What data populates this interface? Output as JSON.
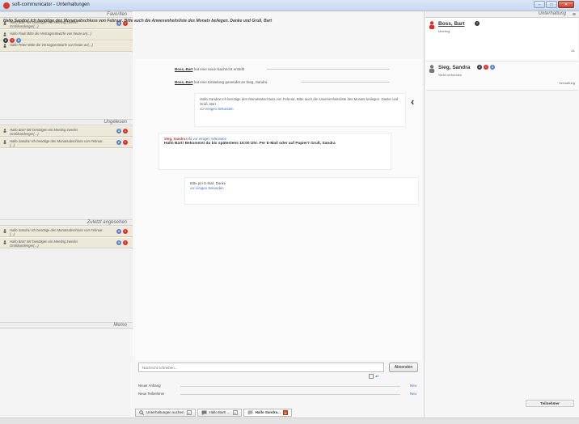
{
  "window": {
    "title": "soft-communicator - Unterhaltungen",
    "minimize": "–",
    "maximize": "□",
    "close": "✕"
  },
  "left": {
    "sections": {
      "favorites": "Favoriten",
      "unread": "Ungelesen",
      "recent": "Zuletzt angesehen",
      "memo": "Memo"
    },
    "favorites": [
      {
        "text": "Hallo Bart! Wir benötigen ein Meeting zwecks Großkundenger(...)",
        "badges": [
          "3",
          "!"
        ]
      },
      {
        "text": "Hallo Paul! Bitte die Vertragsentwürfe von heute an(...)",
        "badges": []
      },
      {
        "text": "Hallo Peter! Bitte die Vertragsentwürfe von heute an(...)",
        "badges": []
      }
    ],
    "unread": [
      {
        "text": "Hallo Bart! Wir benötigen ein Meeting zwecks Großkundenger(...)",
        "badges": [
          "3",
          "!"
        ]
      },
      {
        "text": "Hallo Sandra! Ich benötige den Monatsabschluss von Februar. (...)",
        "badges": [
          "2",
          "!"
        ]
      }
    ],
    "recent": [
      {
        "text": "Hallo Sandra! Ich benötige den Monatsabschluss von Februar. (...)",
        "badges": [
          "2",
          "!"
        ]
      },
      {
        "text": "Hallo Bart! Wir benötigen ein Meeting zwecks Großkundenger(...)",
        "badges": [
          "3",
          "!"
        ]
      }
    ]
  },
  "conversation": {
    "subject": "Hallo Sandra! Ich benötige den Monatsabschluss von Februar. Bitte auch die Anwesenheitsliste des Monats beilegen. Danke und Gruß, Bart",
    "created_prefix": "Erstellt von",
    "created_by": "Boss, Bart",
    "created_time": "vor einigen Sekunden",
    "last_prefix": "Letzte Nachricht von",
    "last_by": "Boss, Bart",
    "last_time": "vor einigen Sekunden",
    "badges": [
      "2",
      "!",
      "2"
    ]
  },
  "chat": {
    "sys1_name": "Boss, Bart",
    "sys1_text": "hat eine neue Nachricht erstellt",
    "sys2_name": "Boss, Bart",
    "sys2_text": "hat eine Einladung gesendet an Sieg, Sandra",
    "msg1_text": "Hallo Sandra! Ich benötige den Monatsabschluss von Februar. Bitte auch die Anwesenheitsliste des Monats beilegen. Danke und Gruß, Bart",
    "msg1_time": "vor einigen Sekunden",
    "msg2_name": "Sieg, Sandra",
    "msg2_label": "Info",
    "msg2_time": "vor einigen Sekunden",
    "msg2_text": "Hallo Bart! Bekommst du bis spätestens 16:00 Uhr. Per E-Mail oder auf Papier? Gruß, Sandra",
    "msg3_text": "Bitte per E-Mail. Danke",
    "msg3_time": "vor einigen Sekunden",
    "back_chevron": "‹"
  },
  "compose": {
    "placeholder": "Nachricht schreiben...",
    "send_label": "Absenden",
    "attachment_label": "Neuer Anhang",
    "participants_label": "Neue Teilnehmer",
    "new_label": "Neu",
    "reply_icon": "↵"
  },
  "right": {
    "header": "Unterhaltung",
    "menu_icon": "≡",
    "participants": [
      {
        "name": "Boss, Bart",
        "sub": "Meeting",
        "badges": [
          "!"
        ],
        "right_label": "AL",
        "color": "#d9302a"
      },
      {
        "name": "Sieg, Sandra",
        "sub": "Nicht verbunden",
        "badges": [
          "2",
          "!",
          "2"
        ],
        "right_label": "Verwaltung",
        "color": "#555555"
      }
    ],
    "tab_label": "Teilnehmer"
  },
  "tabs": [
    {
      "label": "Unterhaltungen suchen",
      "icon": "search-icon"
    },
    {
      "label": "Hallo Bart! ...",
      "icon": "conversation-icon"
    },
    {
      "label": "Hallo Sandra...",
      "icon": "conversation-icon"
    }
  ],
  "colors": {
    "accent": "#3b6fc4",
    "alert": "#d9302a",
    "favorites_bg": "#ece9d8"
  }
}
